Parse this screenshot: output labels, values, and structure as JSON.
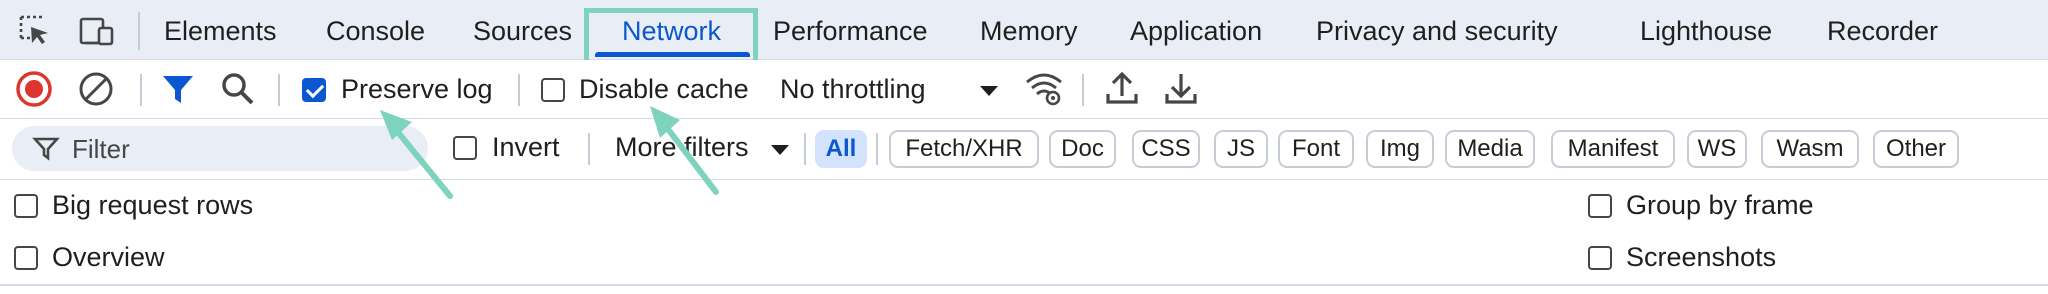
{
  "tabs": {
    "items": [
      {
        "label": "Elements"
      },
      {
        "label": "Console"
      },
      {
        "label": "Sources"
      },
      {
        "label": "Network"
      },
      {
        "label": "Performance"
      },
      {
        "label": "Memory"
      },
      {
        "label": "Application"
      },
      {
        "label": "Privacy and security"
      },
      {
        "label": "Lighthouse"
      },
      {
        "label": "Recorder"
      }
    ],
    "active": "Network",
    "icons": [
      "inspect-element-icon",
      "device-toolbar-icon"
    ]
  },
  "toolbar": {
    "preserve_log": {
      "label": "Preserve log",
      "checked": true
    },
    "disable_cache": {
      "label": "Disable cache",
      "checked": false
    },
    "throttling": {
      "value": "No throttling"
    },
    "icons": [
      "stop-recording-icon",
      "clear-icon",
      "filter-icon",
      "search-icon",
      "network-conditions-icon",
      "import-har-icon",
      "export-har-icon"
    ]
  },
  "filter": {
    "placeholder": "Filter",
    "invert_label": "Invert",
    "more_filters_label": "More filters",
    "types": [
      "All",
      "Fetch/XHR",
      "Doc",
      "CSS",
      "JS",
      "Font",
      "Img",
      "Media",
      "Manifest",
      "WS",
      "Wasm",
      "Other"
    ],
    "selected_type": "All"
  },
  "settings": {
    "big_request_rows": "Big request rows",
    "overview": "Overview",
    "group_by_frame": "Group by frame",
    "screenshots": "Screenshots"
  },
  "colors": {
    "accent": "#0b57d0",
    "tab_bar_bg": "#e9eef6",
    "highlight": "#7ed3bf",
    "record_red": "#dc362e"
  }
}
